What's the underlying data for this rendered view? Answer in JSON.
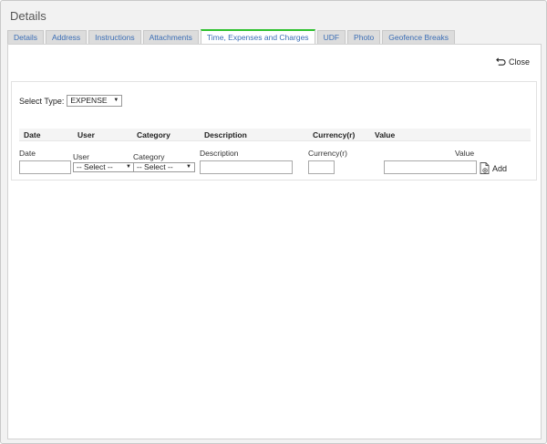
{
  "window": {
    "title": "Details"
  },
  "tabs": [
    {
      "label": "Details",
      "active": false
    },
    {
      "label": "Address",
      "active": false
    },
    {
      "label": "Instructions",
      "active": false
    },
    {
      "label": "Attachments",
      "active": false
    },
    {
      "label": "Time, Expenses and Charges",
      "active": true
    },
    {
      "label": "UDF",
      "active": false
    },
    {
      "label": "Photo",
      "active": false
    },
    {
      "label": "Geofence Breaks",
      "active": false
    }
  ],
  "toolbar": {
    "close_label": "Close",
    "close_icon": "undo-arrow-icon"
  },
  "filter": {
    "label": "Select Type:",
    "value": "EXPENSE"
  },
  "table": {
    "headers": [
      "Date",
      "User",
      "Category",
      "Description",
      "Currency(r)",
      "Value"
    ]
  },
  "entry": {
    "date_label": "Date",
    "user_label": "User",
    "user_value": "-- Select --",
    "category_label": "Category",
    "category_value": "-- Select --",
    "description_label": "Description",
    "currency_label": "Currency(r)",
    "value_label": "Value",
    "add_label": "Add",
    "add_icon": "add-document-icon"
  },
  "colors": {
    "tab_text": "#3a6db5",
    "active_tab_accent": "#2fc12f"
  }
}
